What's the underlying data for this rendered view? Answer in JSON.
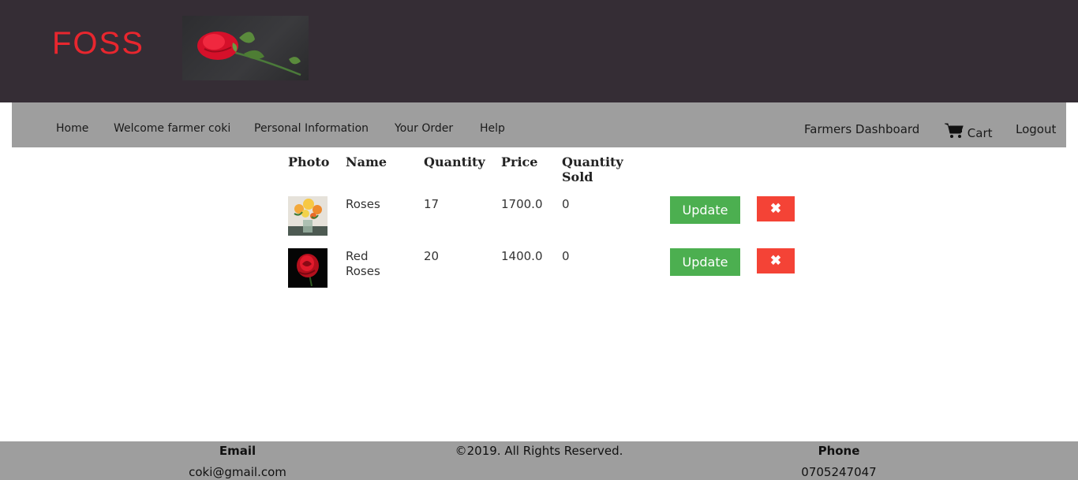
{
  "header": {
    "logo_text": "FOSS",
    "banner_image": "red-rose-banner"
  },
  "nav": {
    "left": [
      {
        "label": "Home"
      },
      {
        "label": "Welcome farmer coki"
      },
      {
        "label": "Personal Information"
      },
      {
        "label": "Your Order"
      },
      {
        "label": "Help"
      }
    ],
    "dashboard": "Farmers Dashboard",
    "cart_icon": "shopping-cart-icon",
    "cart": "Cart",
    "logout": "Logout"
  },
  "table": {
    "headers": {
      "photo": "Photo",
      "name": "Name",
      "quantity": "Quantity",
      "price": "Price",
      "sold_line1": "Quantity",
      "sold_line2": "Sold"
    },
    "rows": [
      {
        "photo": "flower-bouquet-vase",
        "name_line1": "Roses",
        "name_line2": "",
        "quantity": "17",
        "price": "1700.0",
        "sold": "0",
        "update_label": "Update",
        "delete_icon": "close-icon"
      },
      {
        "photo": "red-rose-black-background",
        "name_line1": "Red",
        "name_line2": "Roses",
        "quantity": "20",
        "price": "1400.0",
        "sold": "0",
        "update_label": "Update",
        "delete_icon": "close-icon"
      }
    ]
  },
  "footer": {
    "email_label": "Email",
    "email_value": "coki@gmail.com",
    "copyright": "©2019. All Rights Reserved.",
    "phone_label": "Phone",
    "phone_value": "0705247047"
  },
  "colors": {
    "header_bg": "#352d35",
    "logo": "#e8262e",
    "nav_bg": "#9e9e9e",
    "update_btn": "#4caf50",
    "delete_btn": "#f44336"
  }
}
